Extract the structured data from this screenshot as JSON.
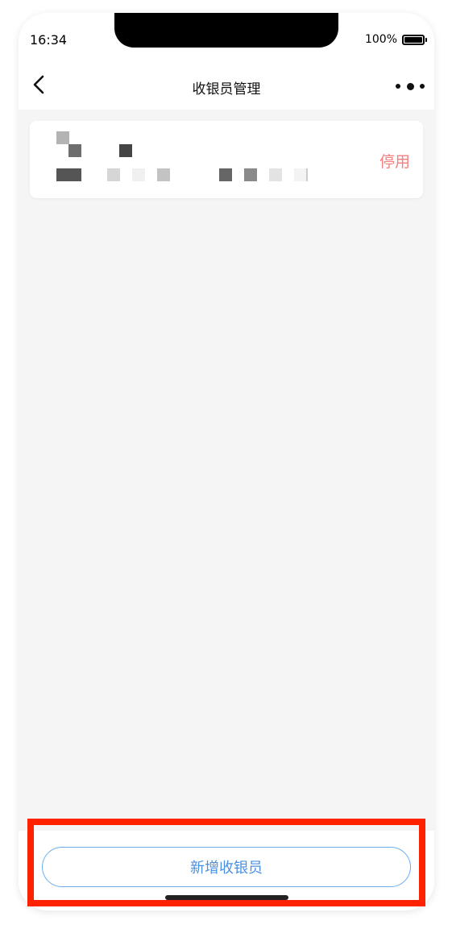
{
  "status_bar": {
    "time": "16:34",
    "battery": "100%"
  },
  "nav": {
    "title": "收银员管理",
    "back_icon": "chevron-left-icon",
    "more_icon": "more-dots-icon"
  },
  "cashier_list": [
    {
      "action_label": "停用"
    }
  ],
  "footer": {
    "add_button_label": "新增收银员"
  },
  "colors": {
    "accent_blue": "#4a90e2",
    "disable_red": "#f57d7d",
    "page_bg": "#f5f5f5",
    "highlight": "#ff2200"
  }
}
